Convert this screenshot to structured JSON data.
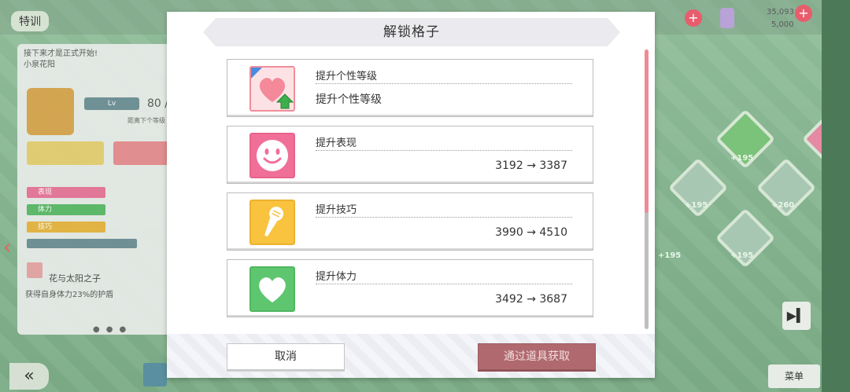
{
  "background": {
    "screen_title": "特训",
    "currency_top": "35,093",
    "currency_bottom": "5,000",
    "card_header_line1": "接下来才是正式开始!",
    "card_header_line2": "小泉花阳",
    "level_label": "Lv",
    "level_value": "80 /",
    "level_sub": "距离下个等级",
    "stat_bars": [
      "表现",
      "体力",
      "技巧"
    ],
    "skill_name": "花与太阳之子",
    "skill_desc": "获得自身体力23%的护盾",
    "node_labels": [
      "+195",
      "+195",
      "+260",
      "+195",
      "+195"
    ],
    "menu_label": "菜单"
  },
  "modal": {
    "title": "解锁格子",
    "rows": [
      {
        "icon": "heart-up-icon",
        "label": "提升个性等级",
        "value": "提升个性等级",
        "color": "#f59aa6"
      },
      {
        "icon": "smile-icon",
        "label": "提升表现",
        "value": "3192 → 3387",
        "color": "#f06f99"
      },
      {
        "icon": "microphone-icon",
        "label": "提升技巧",
        "value": "3990 → 4510",
        "color": "#f9c33f"
      },
      {
        "icon": "heart-icon",
        "label": "提升体力",
        "value": "3492 → 3687",
        "color": "#5ec66f"
      }
    ],
    "buttons": {
      "cancel": "取消",
      "unlock": "通过道具获取"
    }
  }
}
